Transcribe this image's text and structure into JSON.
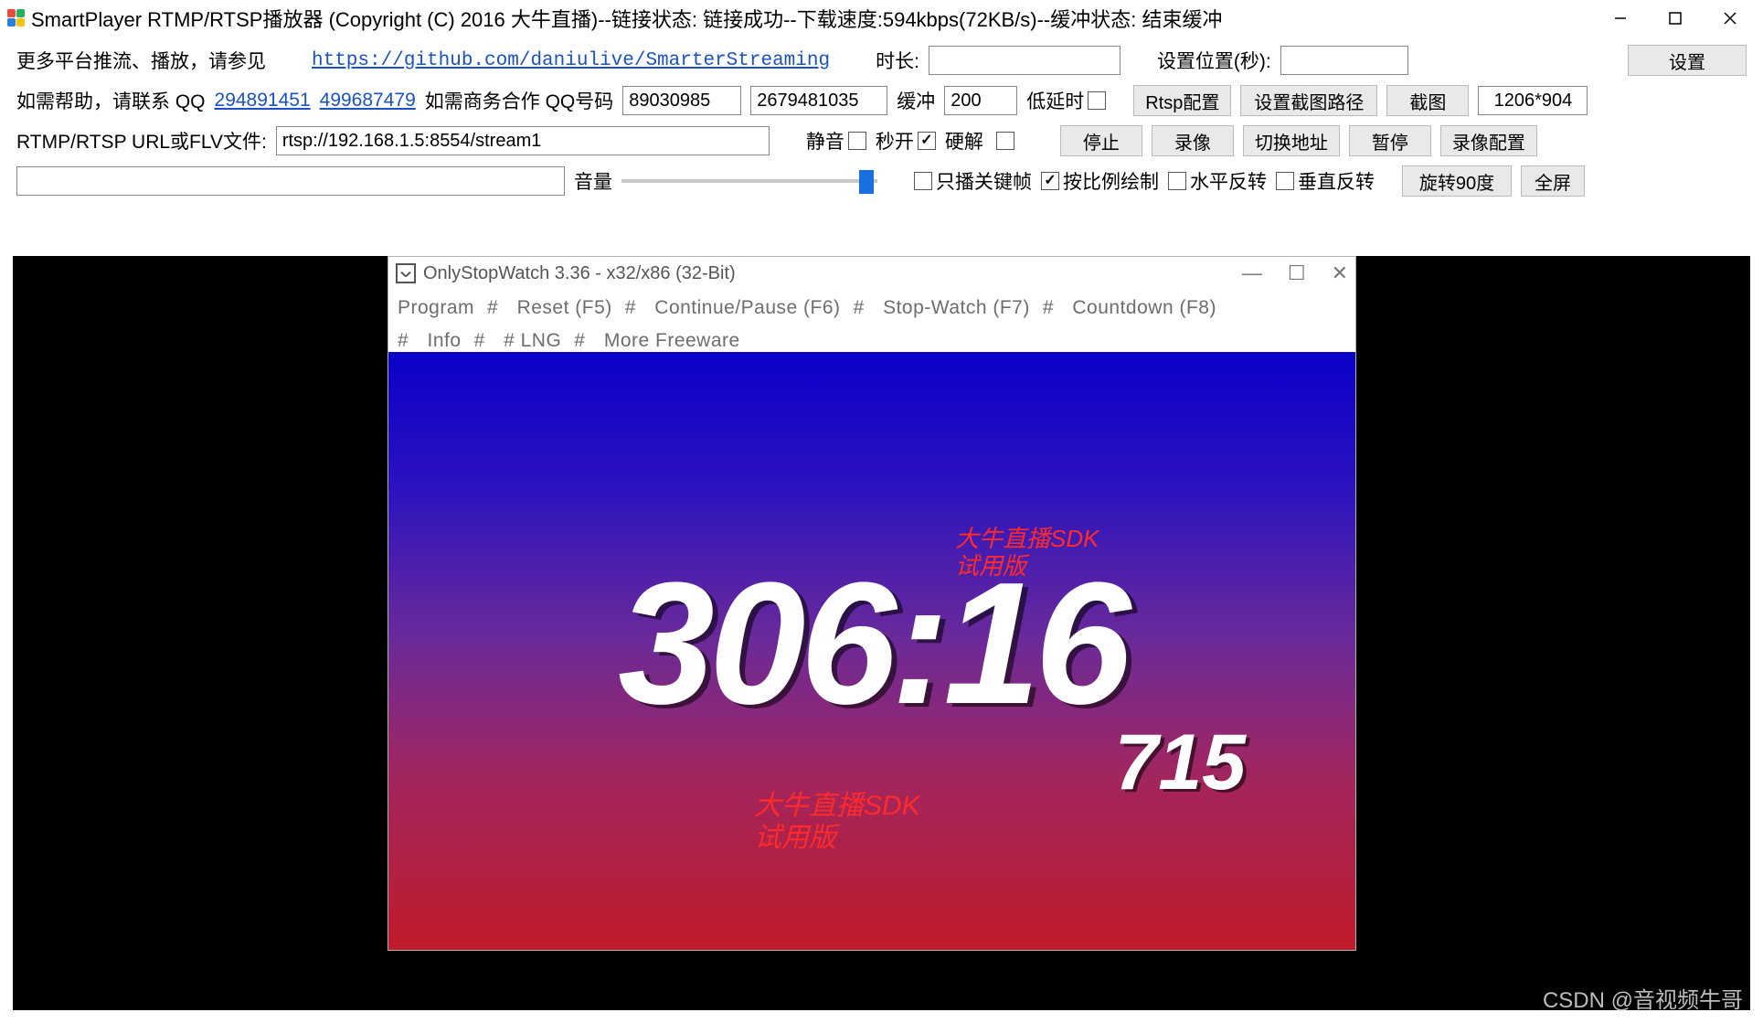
{
  "window": {
    "title": "SmartPlayer RTMP/RTSP播放器 (Copyright (C) 2016 大牛直播)--链接状态: 链接成功--下载速度:594kbps(72KB/s)--缓冲状态: 结束缓冲"
  },
  "row1": {
    "more_platforms": "更多平台推流、播放，请参见",
    "github_url": "https://github.com/daniulive/SmarterStreaming",
    "duration_label": "时长:",
    "duration_value": "",
    "set_pos_label": "设置位置(秒):",
    "set_pos_value": "",
    "settings_btn": "设置"
  },
  "row2": {
    "help_label": "如需帮助，请联系 QQ",
    "qq1": "294891451",
    "qq2": "499687479",
    "biz_label": "如需商务合作 QQ号码",
    "biz_qq1": "89030985",
    "biz_qq2": "2679481035",
    "buffer_label": "缓冲",
    "buffer_value": "200",
    "low_latency": "低延时",
    "rtsp_cfg_btn": "Rtsp配置",
    "screenshot_path_btn": "设置截图路径",
    "screenshot_btn": "截图",
    "resolution": "1206*904"
  },
  "row3": {
    "url_label": "RTMP/RTSP URL或FLV文件:",
    "url_value": "rtsp://192.168.1.5:8554/stream1",
    "mute": "静音",
    "fast_open": "秒开",
    "hw_decode": "硬解",
    "stop_btn": "停止",
    "record_btn": "录像",
    "switch_addr_btn": "切换地址",
    "pause_btn": "暂停",
    "record_cfg_btn": "录像配置"
  },
  "row4": {
    "volume_label": "音量",
    "keyframe_only": "只播关键帧",
    "scale_draw": "按比例绘制",
    "hflip": "水平反转",
    "vflip": "垂直反转",
    "rotate_btn": "旋转90度",
    "fullscreen_btn": "全屏"
  },
  "stopwatch": {
    "title": "OnlyStopWatch 3.36 - x32/x86 (32-Bit)",
    "menu": {
      "program": "Program",
      "reset": "Reset  (F5)",
      "continue": "Continue/Pause  (F6)",
      "stopwatch": "Stop-Watch  (F7)",
      "countdown": "Countdown  (F8)",
      "info": "Info",
      "lng": "# LNG",
      "more": "More Freeware"
    },
    "main_time": "306:16",
    "sub_time": "715",
    "watermark_line1": "大牛直播SDK",
    "watermark_line2": "试用版"
  },
  "footer": {
    "csdn": "CSDN @音视频牛哥"
  }
}
